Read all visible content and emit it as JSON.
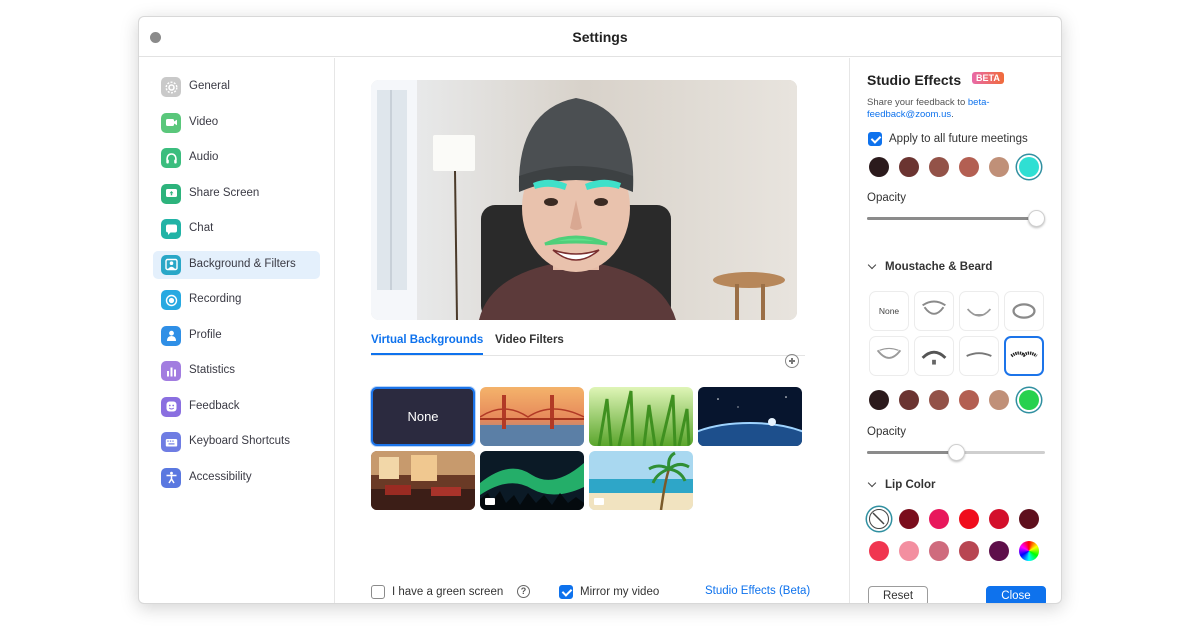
{
  "window": {
    "title": "Settings"
  },
  "sidebar": {
    "items": [
      {
        "label": "General",
        "icon": "gear-icon",
        "color": "#c9c9c9",
        "active": false
      },
      {
        "label": "Video",
        "icon": "video-icon",
        "color": "#5ac77b",
        "active": false
      },
      {
        "label": "Audio",
        "icon": "headphones-icon",
        "color": "#3bbd7e",
        "active": false
      },
      {
        "label": "Share Screen",
        "icon": "share-screen-icon",
        "color": "#2db37c",
        "active": false
      },
      {
        "label": "Chat",
        "icon": "chat-icon",
        "color": "#21b3a6",
        "active": false
      },
      {
        "label": "Background & Filters",
        "icon": "background-icon",
        "color": "#29a7c7",
        "active": true
      },
      {
        "label": "Recording",
        "icon": "recording-icon",
        "color": "#27a9e1",
        "active": false
      },
      {
        "label": "Profile",
        "icon": "profile-icon",
        "color": "#2f8fe6",
        "active": false
      },
      {
        "label": "Statistics",
        "icon": "statistics-icon",
        "color": "#a27de0",
        "active": false
      },
      {
        "label": "Feedback",
        "icon": "feedback-icon",
        "color": "#8a6fe0",
        "active": false
      },
      {
        "label": "Keyboard Shortcuts",
        "icon": "keyboard-icon",
        "color": "#6f7de3",
        "active": false
      },
      {
        "label": "Accessibility",
        "icon": "accessibility-icon",
        "color": "#5a78e0",
        "active": false
      }
    ]
  },
  "main": {
    "tabs": [
      {
        "label": "Virtual Backgrounds",
        "active": true
      },
      {
        "label": "Video Filters",
        "active": false
      }
    ],
    "add_icon": "plus-circle-icon",
    "backgrounds": [
      {
        "label": "None",
        "kind": "none",
        "selected": true
      },
      {
        "label": "",
        "kind": "golden-gate-bridge",
        "selected": false
      },
      {
        "label": "",
        "kind": "grass",
        "selected": false
      },
      {
        "label": "",
        "kind": "earth-from-space",
        "selected": false
      },
      {
        "label": "",
        "kind": "interior-room",
        "selected": false
      },
      {
        "label": "",
        "kind": "aurora",
        "video": true,
        "selected": false
      },
      {
        "label": "",
        "kind": "beach",
        "video": true,
        "selected": false
      }
    ],
    "green_screen": {
      "label": "I have a green screen",
      "checked": false
    },
    "mirror": {
      "label": "Mirror my video",
      "checked": true
    },
    "studio_link": "Studio Effects (Beta)"
  },
  "studio": {
    "title": "Studio Effects",
    "badge": "BETA",
    "feedback_text": "Share your feedback to ",
    "feedback_email": "beta-feedback@zoom.us",
    "feedback_suffix": ".",
    "apply": {
      "label": "Apply to all future meetings",
      "checked": true
    },
    "eyebrow_colors": [
      "#2b1a1c",
      "#6b3431",
      "#935248",
      "#b35f52",
      "#c09078",
      "#2fdfd3"
    ],
    "eyebrow_selected": 5,
    "eyebrow_opacity_label": "Opacity",
    "eyebrow_opacity": 0.95,
    "moustache": {
      "title": "Moustache & Beard",
      "options": [
        "None",
        "",
        "",
        "",
        "",
        "",
        "",
        ""
      ],
      "selected": 7,
      "colors": [
        "#2b1a1c",
        "#6b3431",
        "#935248",
        "#b35f52",
        "#c09078",
        "#27d14e"
      ],
      "color_selected": 5,
      "opacity_label": "Opacity",
      "opacity": 0.5
    },
    "lip": {
      "title": "Lip Color",
      "colors_row1": [
        "none",
        "#7a0d1c",
        "#e8185c",
        "#f00d1c",
        "#d30f2b",
        "#5e0f1d"
      ],
      "colors_row2": [
        "#f03650",
        "#f38fa0",
        "#cf6b7d",
        "#b84652",
        "#5e0f4a",
        "rainbow"
      ],
      "selected": 0
    },
    "reset_label": "Reset",
    "close_label": "Close"
  }
}
